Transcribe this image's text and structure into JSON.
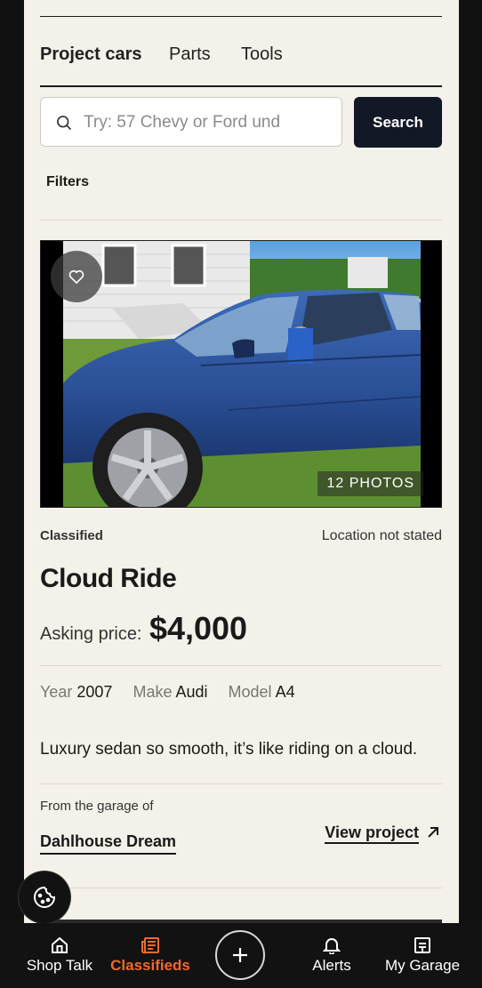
{
  "tabs": [
    {
      "label": "Project cars",
      "active": true
    },
    {
      "label": "Parts",
      "active": false
    },
    {
      "label": "Tools",
      "active": false
    }
  ],
  "search": {
    "placeholder": "Try: 57 Chevy or Ford und",
    "value": "",
    "button_label": "Search"
  },
  "filters_label": "Filters",
  "listing": {
    "photo_count": "12 PHOTOS",
    "category": "Classified",
    "location": "Location not stated",
    "title": "Cloud Ride",
    "price_label": "Asking price:",
    "price": "$4,000",
    "specs": [
      {
        "key": "Year",
        "value": "2007"
      },
      {
        "key": "Make",
        "value": "Audi"
      },
      {
        "key": "Model",
        "value": "A4"
      }
    ],
    "description": "Luxury sedan so smooth, it’s like riding on a cloud.",
    "from_label": "From the garage of",
    "garage_name": "Dahlhouse Dream",
    "view_project_label": "View project"
  },
  "bottom_nav": [
    {
      "label": "Shop Talk",
      "icon": "home-icon",
      "active": false
    },
    {
      "label": "Classifieds",
      "icon": "newspaper-icon",
      "active": true
    },
    {
      "label": "",
      "icon": "plus-icon",
      "active": false
    },
    {
      "label": "Alerts",
      "icon": "bell-icon",
      "active": false
    },
    {
      "label": "My Garage",
      "icon": "garage-icon",
      "active": false
    }
  ],
  "colors": {
    "accent": "#f06a2a",
    "page_bg": "#f4f1ea",
    "button_dark": "#121826"
  }
}
